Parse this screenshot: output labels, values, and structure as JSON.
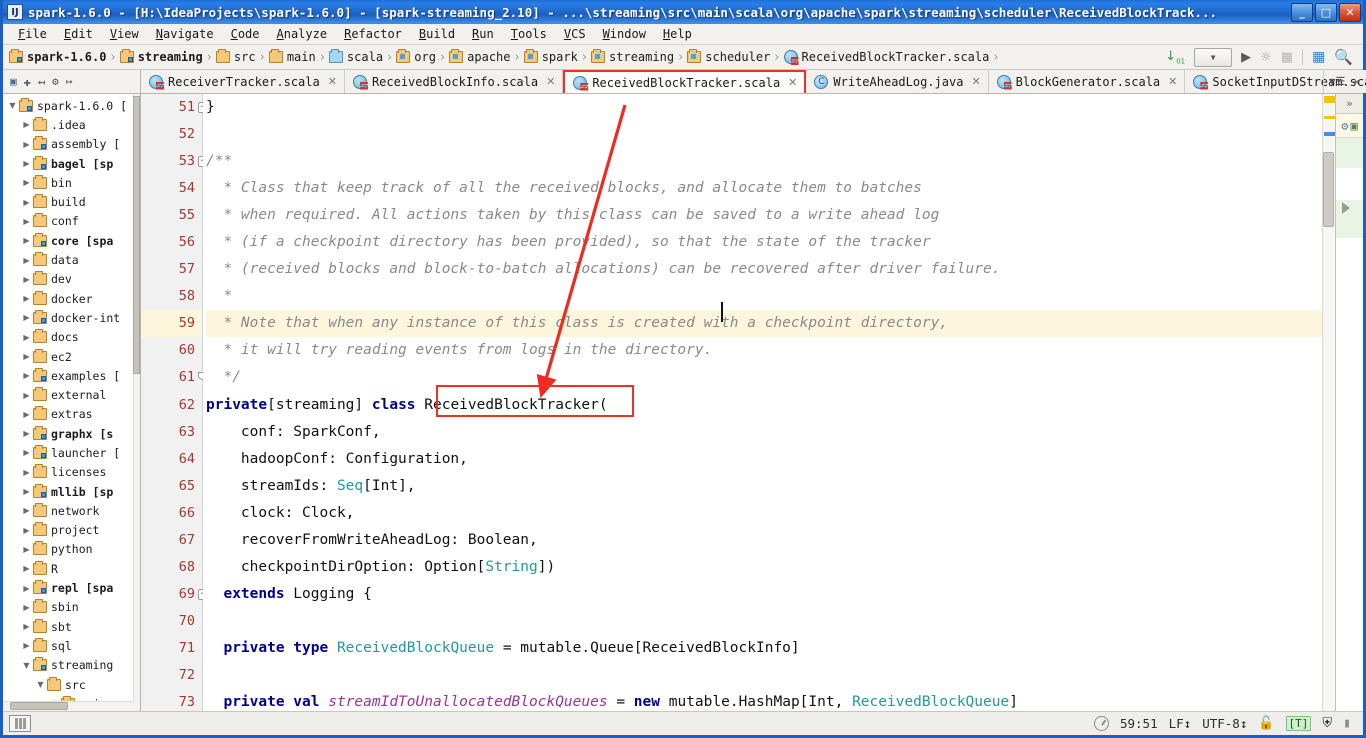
{
  "window": {
    "title": "spark-1.6.0 - [H:\\IdeaProjects\\spark-1.6.0] - [spark-streaming_2.10] - ...\\streaming\\src\\main\\scala\\org\\apache\\spark\\streaming\\scheduler\\ReceivedBlockTrack...",
    "app_icon_label": "IJ",
    "minimize_label": "_",
    "maximize_label": "□",
    "close_label": "✕"
  },
  "menubar": {
    "items": [
      "File",
      "Edit",
      "View",
      "Navigate",
      "Code",
      "Analyze",
      "Refactor",
      "Build",
      "Run",
      "Tools",
      "VCS",
      "Window",
      "Help"
    ]
  },
  "breadcrumb": {
    "separator": "›",
    "items": [
      {
        "label": "spark-1.6.0",
        "icon": "module-folder-icon",
        "bold": true,
        "kind": "module"
      },
      {
        "label": "streaming",
        "icon": "module-folder-icon",
        "bold": true,
        "kind": "module"
      },
      {
        "label": "src",
        "icon": "folder-icon",
        "bold": false,
        "kind": "folder"
      },
      {
        "label": "main",
        "icon": "folder-icon",
        "bold": false,
        "kind": "folder"
      },
      {
        "label": "scala",
        "icon": "source-folder-icon",
        "bold": false,
        "kind": "source"
      },
      {
        "label": "org",
        "icon": "package-icon",
        "bold": false,
        "kind": "package"
      },
      {
        "label": "apache",
        "icon": "package-icon",
        "bold": false,
        "kind": "package"
      },
      {
        "label": "spark",
        "icon": "package-icon",
        "bold": false,
        "kind": "package"
      },
      {
        "label": "streaming",
        "icon": "package-icon",
        "bold": false,
        "kind": "package"
      },
      {
        "label": "scheduler",
        "icon": "package-icon",
        "bold": false,
        "kind": "package"
      },
      {
        "label": "ReceivedBlockTracker.scala",
        "icon": "scala-file-icon",
        "bold": false,
        "kind": "scala"
      }
    ]
  },
  "toolbar_right": {
    "items": [
      "sort-order-icon",
      "run-configuration-dropdown",
      "run-icon",
      "debug-icon",
      "coverage-icon",
      "project-structure-icon",
      "search-icon"
    ]
  },
  "left_toolbar": {
    "items": [
      "project-view-icon",
      "locate-icon",
      "collapse-all-icon",
      "settings-gear-icon",
      "hide-panel-icon"
    ]
  },
  "tabs": {
    "items": [
      {
        "label": "ReceiverTracker.scala",
        "icon": "scala-file-icon",
        "active": false,
        "close": "✕"
      },
      {
        "label": "ReceivedBlockInfo.scala",
        "icon": "scala-file-icon",
        "active": false,
        "close": "✕"
      },
      {
        "label": "ReceivedBlockTracker.scala",
        "icon": "scala-file-icon",
        "active": true,
        "close": "✕"
      },
      {
        "label": "WriteAheadLog.java",
        "icon": "java-file-icon",
        "active": false,
        "close": "✕"
      },
      {
        "label": "BlockGenerator.scala",
        "icon": "scala-file-icon",
        "active": false,
        "close": "✕"
      },
      {
        "label": "SocketInputDStream.scala",
        "icon": "scala-file-icon",
        "active": false,
        "close": "✕"
      }
    ],
    "overflow_icon": "tab-list-icon",
    "hide_icon": "hide-tabs-icon"
  },
  "project_tree": {
    "nodes": [
      {
        "label": "spark-1.6.0 [",
        "depth": 0,
        "expanded": true,
        "icon": "module-folder-icon",
        "bold": false
      },
      {
        "label": ".idea",
        "depth": 1,
        "expanded": false,
        "icon": "folder-icon",
        "bold": false
      },
      {
        "label": "assembly [",
        "depth": 1,
        "expanded": false,
        "icon": "module-folder-icon",
        "bold": false
      },
      {
        "label": "bagel [sp",
        "depth": 1,
        "expanded": false,
        "icon": "module-folder-icon",
        "bold": true
      },
      {
        "label": "bin",
        "depth": 1,
        "expanded": false,
        "icon": "folder-icon",
        "bold": false
      },
      {
        "label": "build",
        "depth": 1,
        "expanded": false,
        "icon": "folder-icon",
        "bold": false
      },
      {
        "label": "conf",
        "depth": 1,
        "expanded": false,
        "icon": "folder-icon",
        "bold": false
      },
      {
        "label": "core [spa",
        "depth": 1,
        "expanded": false,
        "icon": "module-folder-icon",
        "bold": true
      },
      {
        "label": "data",
        "depth": 1,
        "expanded": false,
        "icon": "folder-icon",
        "bold": false
      },
      {
        "label": "dev",
        "depth": 1,
        "expanded": false,
        "icon": "folder-icon",
        "bold": false
      },
      {
        "label": "docker",
        "depth": 1,
        "expanded": false,
        "icon": "folder-icon",
        "bold": false
      },
      {
        "label": "docker-int",
        "depth": 1,
        "expanded": false,
        "icon": "module-folder-icon",
        "bold": false
      },
      {
        "label": "docs",
        "depth": 1,
        "expanded": false,
        "icon": "folder-icon",
        "bold": false
      },
      {
        "label": "ec2",
        "depth": 1,
        "expanded": false,
        "icon": "folder-icon",
        "bold": false
      },
      {
        "label": "examples [",
        "depth": 1,
        "expanded": false,
        "icon": "module-folder-icon",
        "bold": false
      },
      {
        "label": "external",
        "depth": 1,
        "expanded": false,
        "icon": "folder-icon",
        "bold": false
      },
      {
        "label": "extras",
        "depth": 1,
        "expanded": false,
        "icon": "folder-icon",
        "bold": false
      },
      {
        "label": "graphx [s",
        "depth": 1,
        "expanded": false,
        "icon": "module-folder-icon",
        "bold": true
      },
      {
        "label": "launcher [",
        "depth": 1,
        "expanded": false,
        "icon": "module-folder-icon",
        "bold": false
      },
      {
        "label": "licenses",
        "depth": 1,
        "expanded": false,
        "icon": "folder-icon",
        "bold": false
      },
      {
        "label": "mllib [sp",
        "depth": 1,
        "expanded": false,
        "icon": "module-folder-icon",
        "bold": true
      },
      {
        "label": "network",
        "depth": 1,
        "expanded": false,
        "icon": "folder-icon",
        "bold": false
      },
      {
        "label": "project",
        "depth": 1,
        "expanded": false,
        "icon": "folder-icon",
        "bold": false
      },
      {
        "label": "python",
        "depth": 1,
        "expanded": false,
        "icon": "folder-icon",
        "bold": false
      },
      {
        "label": "R",
        "depth": 1,
        "expanded": false,
        "icon": "folder-icon",
        "bold": false
      },
      {
        "label": "repl [spa",
        "depth": 1,
        "expanded": false,
        "icon": "module-folder-icon",
        "bold": true
      },
      {
        "label": "sbin",
        "depth": 1,
        "expanded": false,
        "icon": "folder-icon",
        "bold": false
      },
      {
        "label": "sbt",
        "depth": 1,
        "expanded": false,
        "icon": "folder-icon",
        "bold": false
      },
      {
        "label": "sql",
        "depth": 1,
        "expanded": false,
        "icon": "folder-icon",
        "bold": false
      },
      {
        "label": "streaming",
        "depth": 1,
        "expanded": true,
        "icon": "module-folder-icon",
        "bold": false
      },
      {
        "label": "src",
        "depth": 2,
        "expanded": true,
        "icon": "folder-icon",
        "bold": false
      },
      {
        "label": "mai",
        "depth": 3,
        "expanded": true,
        "icon": "folder-icon",
        "bold": false
      }
    ]
  },
  "editor": {
    "first_line": 51,
    "highlighted_line": 59,
    "lines": [
      {
        "n": 51,
        "fold": "minus",
        "tokens": [
          {
            "t": "}",
            "c": "plain"
          }
        ]
      },
      {
        "n": 52,
        "fold": "",
        "tokens": []
      },
      {
        "n": 53,
        "fold": "minus",
        "tokens": [
          {
            "t": "/**",
            "c": "cmt"
          }
        ]
      },
      {
        "n": 54,
        "fold": "",
        "tokens": [
          {
            "t": "  * Class that keep track of all the received blocks, and allocate them to batches",
            "c": "cmt"
          }
        ]
      },
      {
        "n": 55,
        "fold": "",
        "tokens": [
          {
            "t": "  * when required. All actions taken by this class can be saved to a write ahead log",
            "c": "cmt"
          }
        ]
      },
      {
        "n": 56,
        "fold": "",
        "tokens": [
          {
            "t": "  * (if a checkpoint directory has been provided), so that the state of the tracker",
            "c": "cmt"
          }
        ]
      },
      {
        "n": 57,
        "fold": "",
        "tokens": [
          {
            "t": "  * (received blocks and block-to-batch allocations) can be recovered after driver failure.",
            "c": "cmt"
          }
        ]
      },
      {
        "n": 58,
        "fold": "",
        "tokens": [
          {
            "t": "  *",
            "c": "cmt"
          }
        ]
      },
      {
        "n": 59,
        "fold": "",
        "tokens": [
          {
            "t": "  * Note that when any instance of this class is created with a checkpoint directory,",
            "c": "cmt"
          }
        ]
      },
      {
        "n": 60,
        "fold": "",
        "tokens": [
          {
            "t": "  * it will try reading events from logs in the directory.",
            "c": "cmt"
          }
        ]
      },
      {
        "n": 61,
        "fold": "fold",
        "tokens": [
          {
            "t": "  */",
            "c": "cmt"
          }
        ]
      },
      {
        "n": 62,
        "fold": "",
        "tokens": [
          {
            "t": "private",
            "c": "kw"
          },
          {
            "t": "[streaming] ",
            "c": "plain"
          },
          {
            "t": "class",
            "c": "kw"
          },
          {
            "t": " ReceivedBlockTracker(",
            "c": "plain"
          }
        ]
      },
      {
        "n": 63,
        "fold": "",
        "tokens": [
          {
            "t": "    conf: SparkConf,",
            "c": "plain"
          }
        ]
      },
      {
        "n": 64,
        "fold": "",
        "tokens": [
          {
            "t": "    hadoopConf: Configuration,",
            "c": "plain"
          }
        ]
      },
      {
        "n": 65,
        "fold": "",
        "tokens": [
          {
            "t": "    streamIds: ",
            "c": "plain"
          },
          {
            "t": "Seq",
            "c": "typ"
          },
          {
            "t": "[Int],",
            "c": "plain"
          }
        ]
      },
      {
        "n": 66,
        "fold": "",
        "tokens": [
          {
            "t": "    clock: Clock,",
            "c": "plain"
          }
        ]
      },
      {
        "n": 67,
        "fold": "",
        "tokens": [
          {
            "t": "    recoverFromWriteAheadLog: Boolean,",
            "c": "plain"
          }
        ]
      },
      {
        "n": 68,
        "fold": "",
        "tokens": [
          {
            "t": "    checkpointDirOption: Option[",
            "c": "plain"
          },
          {
            "t": "String",
            "c": "typ"
          },
          {
            "t": "])",
            "c": "plain"
          }
        ]
      },
      {
        "n": 69,
        "fold": "minus",
        "tokens": [
          {
            "t": "  extends",
            "c": "kw"
          },
          {
            "t": " Logging {",
            "c": "plain"
          }
        ]
      },
      {
        "n": 70,
        "fold": "",
        "tokens": []
      },
      {
        "n": 71,
        "fold": "",
        "tokens": [
          {
            "t": "  private type",
            "c": "kw"
          },
          {
            "t": " ",
            "c": "plain"
          },
          {
            "t": "ReceivedBlockQueue",
            "c": "typ"
          },
          {
            "t": " = mutable.Queue[ReceivedBlockInfo]",
            "c": "plain"
          }
        ]
      },
      {
        "n": 72,
        "fold": "",
        "tokens": []
      },
      {
        "n": 73,
        "fold": "",
        "tokens": [
          {
            "t": "  private val",
            "c": "kw"
          },
          {
            "t": " ",
            "c": "plain"
          },
          {
            "t": "streamIdToUnallocatedBlockQueues",
            "c": "ital"
          },
          {
            "t": " = ",
            "c": "plain"
          },
          {
            "t": "new",
            "c": "kw"
          },
          {
            "t": " mutable.HashMap[Int, ",
            "c": "plain"
          },
          {
            "t": "ReceivedBlockQueue",
            "c": "typ"
          },
          {
            "t": "]",
            "c": "plain"
          }
        ]
      }
    ]
  },
  "annotations": {
    "accent_color": "#ef3124",
    "arrow_from": "active-tab ReceivedBlockTracker.scala",
    "arrow_to": "class name ReceivedBlockTracker on line 62",
    "boxes": [
      "active-tab-highlight",
      "class-name-highlight"
    ]
  },
  "statusbar": {
    "caret_position": "59:51",
    "line_separator": "LF↕",
    "encoding": "UTF-8↕",
    "lock_icon": "unlocked-icon",
    "indicator": "[T]",
    "train_icon": "hector-inspection-icon",
    "event_log_icon": "event-log-icon",
    "progress_icon": "background-tasks-icon",
    "toggle_toolbar_icon": "show-tool-windows-icon"
  },
  "right_strip": {
    "collapse_label": "»",
    "icons": [
      "database-icon",
      "maven-projects-icon"
    ]
  }
}
